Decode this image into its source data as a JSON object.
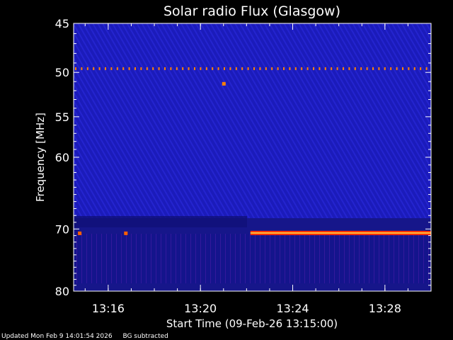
{
  "chart_data": {
    "type": "heatmap",
    "title": "Solar radio Flux (Glasgow)",
    "xlabel": "Start Time (09-Feb-26 13:15:00)",
    "ylabel": "Frequency [MHz]",
    "xlim": [
      "13:14:30",
      "13:30:00"
    ],
    "ylim": [
      45,
      80
    ],
    "y_scale": "log",
    "x_ticks": [
      "13:16",
      "13:20",
      "13:24",
      "13:28"
    ],
    "y_ticks": [
      45,
      50,
      55,
      60,
      70,
      80
    ],
    "colormap": [
      "#000060",
      "#1a1aa0",
      "#2a2ad0",
      "#3030ff",
      "#ff3000",
      "#ffa000",
      "#ffff80"
    ],
    "background_color": "#1e1ebe",
    "features": [
      {
        "kind": "dotted_line",
        "freq_mhz": 49.6,
        "t_start": "13:14:30",
        "t_end": "13:29:50",
        "color": "#ff8000"
      },
      {
        "kind": "blip",
        "freq_mhz": 51.2,
        "time": "13:21:00",
        "color": "#ff8000"
      },
      {
        "kind": "band",
        "freq_mhz": 70.6,
        "t_start": "13:22:10",
        "t_end": "13:30:00",
        "color": "#ff6000"
      },
      {
        "kind": "blip",
        "freq_mhz": 70.6,
        "time": "13:14:45",
        "color": "#ff6000"
      },
      {
        "kind": "blip",
        "freq_mhz": 70.6,
        "time": "13:16:45",
        "color": "#ff6000"
      }
    ]
  },
  "footer": {
    "updated": "Updated Mon Feb  9 14:01:54 2026",
    "note": "BG subtracted"
  }
}
